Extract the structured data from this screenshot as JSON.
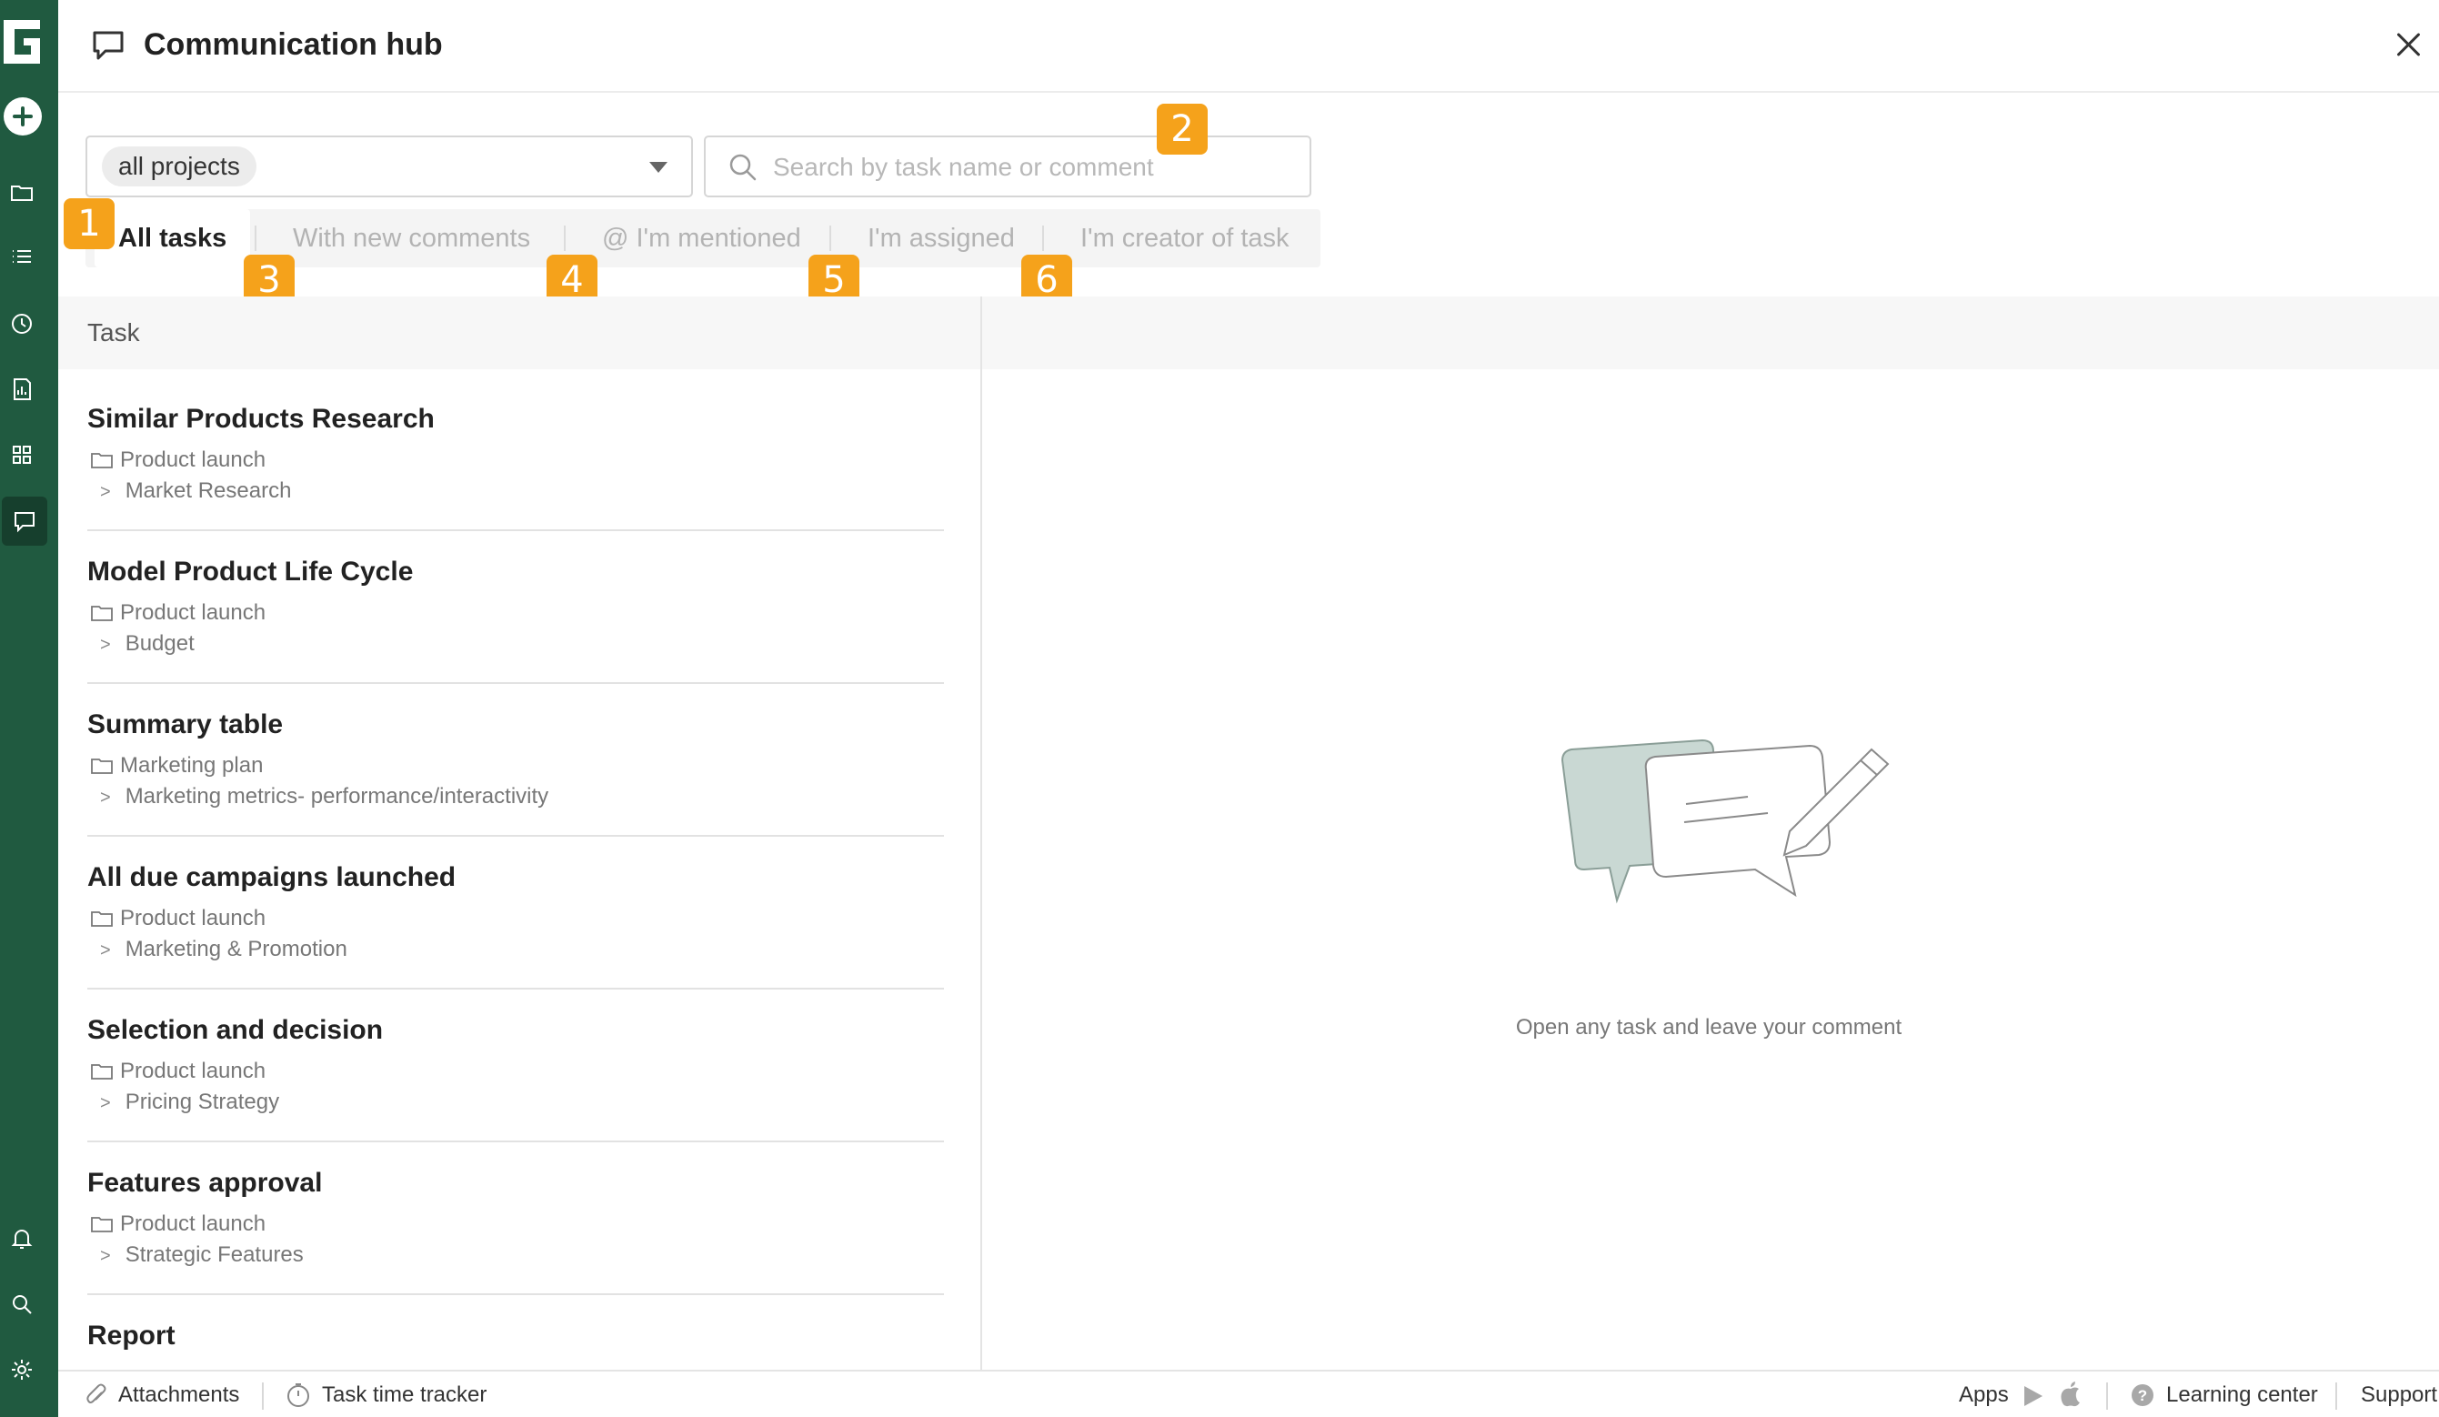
{
  "header": {
    "title": "Communication hub"
  },
  "filters": {
    "project_select_value": "all projects",
    "search_placeholder": "Search by task name or comment"
  },
  "tabs": [
    {
      "label": "All tasks",
      "active": true
    },
    {
      "label": "With new comments",
      "active": false
    },
    {
      "label": "@ I'm mentioned",
      "active": false
    },
    {
      "label": "I'm assigned",
      "active": false
    },
    {
      "label": "I'm creator of task",
      "active": false
    }
  ],
  "badges": [
    "1",
    "2",
    "3",
    "4",
    "5",
    "6"
  ],
  "column_header": "Task",
  "tasks": [
    {
      "name": "Similar Products Research",
      "project": "Product launch",
      "section": "Market Research"
    },
    {
      "name": "Model Product Life Cycle",
      "project": "Product launch",
      "section": "Budget"
    },
    {
      "name": "Summary table",
      "project": "Marketing plan",
      "section": "Marketing metrics- performance/interactivity"
    },
    {
      "name": "All due campaigns launched",
      "project": "Product launch",
      "section": "Marketing & Promotion"
    },
    {
      "name": "Selection and decision",
      "project": "Product launch",
      "section": "Pricing Strategy"
    },
    {
      "name": "Features approval",
      "project": "Product launch",
      "section": "Strategic Features"
    },
    {
      "name": "Report",
      "project": "",
      "section": ""
    }
  ],
  "section_arrow": ">",
  "empty_state": {
    "text": "Open any task and leave your comment"
  },
  "footer": {
    "attachments": "Attachments",
    "time_tracker": "Task time tracker",
    "apps": "Apps",
    "learning_center": "Learning center",
    "support": "Support"
  },
  "colors": {
    "sidebar": "#205a40",
    "badge": "#f5a21b"
  }
}
